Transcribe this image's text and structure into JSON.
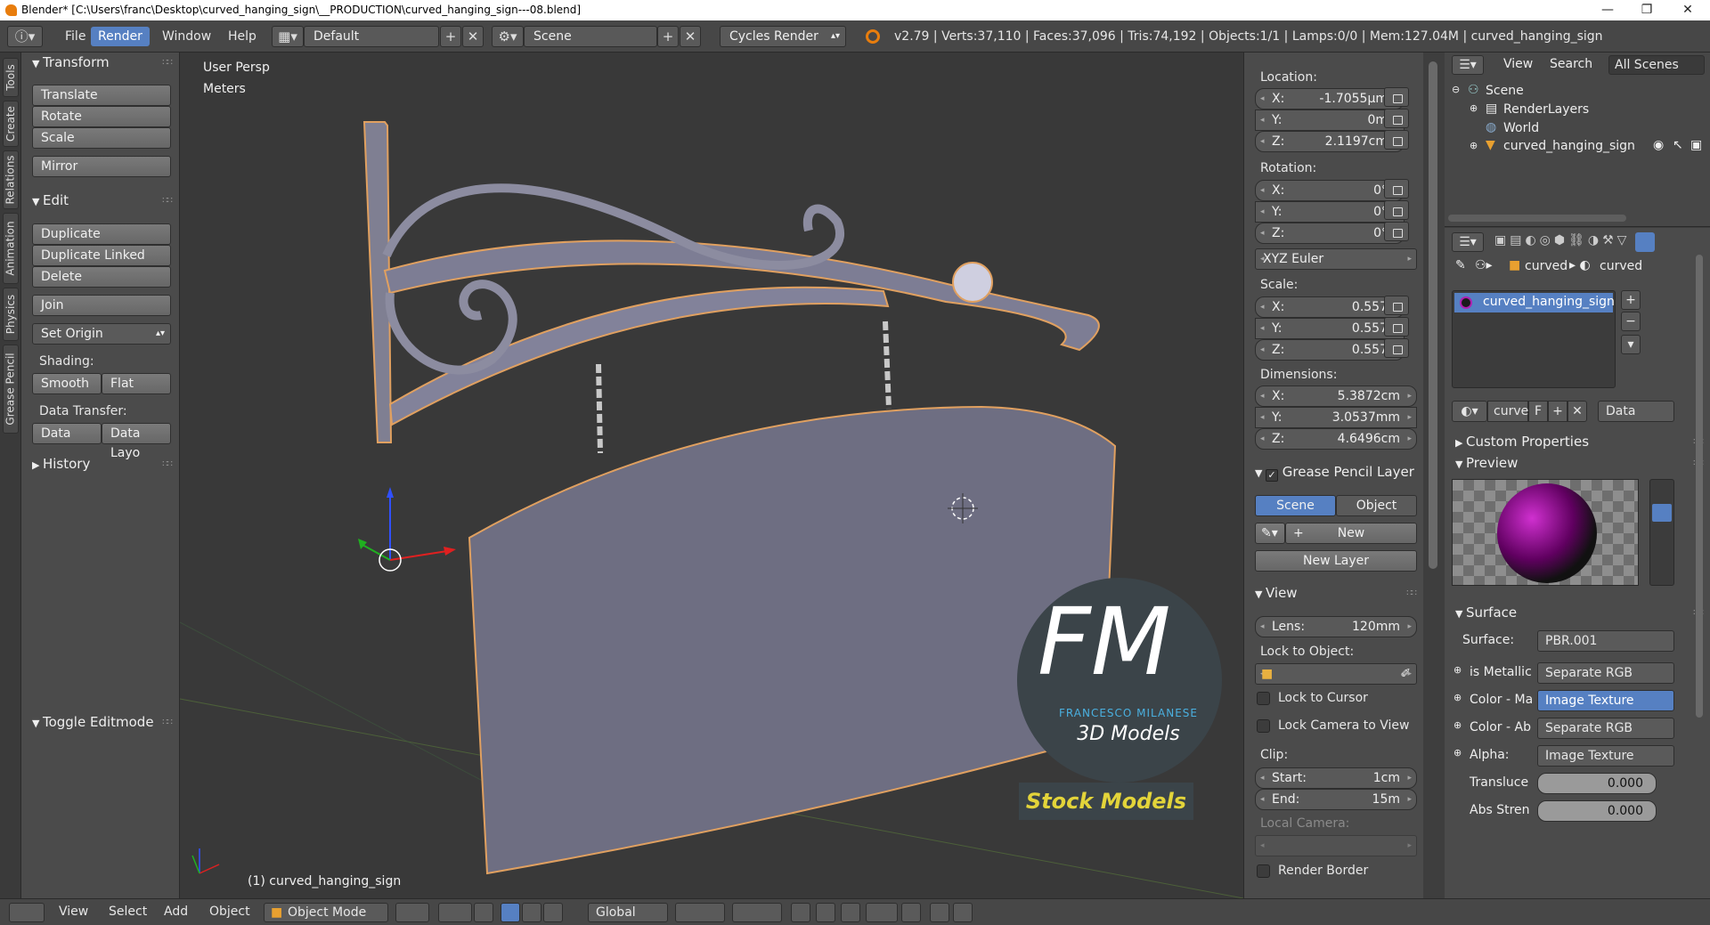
{
  "window": {
    "title": "Blender* [C:\\Users\\franc\\Desktop\\curved_hanging_sign\\__PRODUCTION\\curved_hanging_sign---08.blend]"
  },
  "topbar": {
    "menus": [
      "File",
      "Render",
      "Window",
      "Help"
    ],
    "layout": "Default",
    "scene": "Scene",
    "engine": "Cycles Render",
    "stats": "v2.79 | Verts:37,110 | Faces:37,096 | Tris:74,192 | Objects:1/1 | Lamps:0/0 | Mem:127.04M | curved_hanging_sign"
  },
  "lefttabs": [
    "Tools",
    "Create",
    "Relations",
    "Animation",
    "Physics",
    "Grease Pencil"
  ],
  "toolshelf": {
    "transform_title": "Transform",
    "translate": "Translate",
    "rotate": "Rotate",
    "scale": "Scale",
    "mirror": "Mirror",
    "edit_title": "Edit",
    "duplicate": "Duplicate",
    "duplicate_linked": "Duplicate Linked",
    "delete": "Delete",
    "join": "Join",
    "set_origin": "Set Origin",
    "shading_label": "Shading:",
    "smooth": "Smooth",
    "flat": "Flat",
    "data_transfer_label": "Data Transfer:",
    "data": "Data",
    "data_layo": "Data Layo",
    "history_title": "History",
    "toggle_editmode": "Toggle Editmode"
  },
  "viewport": {
    "view_name": "User Persp",
    "units": "Meters",
    "object_label": "(1) curved_hanging_sign",
    "watermark": {
      "big": "FM",
      "name": "FRANCESCO MILANESE",
      "sub": "3D Models",
      "stock": "Stock Models"
    }
  },
  "npanel": {
    "location_label": "Location:",
    "loc": [
      {
        "k": "X:",
        "v": "-1.7055µm"
      },
      {
        "k": "Y:",
        "v": "0m"
      },
      {
        "k": "Z:",
        "v": "2.1197cm"
      }
    ],
    "rotation_label": "Rotation:",
    "rot": [
      {
        "k": "X:",
        "v": "0°"
      },
      {
        "k": "Y:",
        "v": "0°"
      },
      {
        "k": "Z:",
        "v": "0°"
      }
    ],
    "rotation_mode": "XYZ Euler",
    "scale_label": "Scale:",
    "scl": [
      {
        "k": "X:",
        "v": "0.557"
      },
      {
        "k": "Y:",
        "v": "0.557"
      },
      {
        "k": "Z:",
        "v": "0.557"
      }
    ],
    "dimensions_label": "Dimensions:",
    "dim": [
      {
        "k": "X:",
        "v": "5.3872cm"
      },
      {
        "k": "Y:",
        "v": "3.0537mm"
      },
      {
        "k": "Z:",
        "v": "4.6496cm"
      }
    ],
    "gp_title": "Grease Pencil Layer",
    "gp_scene": "Scene",
    "gp_object": "Object",
    "gp_new": "New",
    "gp_new_layer": "New Layer",
    "view_title": "View",
    "lens_label": "Lens:",
    "lens_value": "120mm",
    "lock_to_object": "Lock to Object:",
    "lock_cursor": "Lock to Cursor",
    "lock_camera": "Lock Camera to View",
    "clip_label": "Clip:",
    "clip_start_label": "Start:",
    "clip_start": "1cm",
    "clip_end_label": "End:",
    "clip_end": "15m",
    "local_camera": "Local Camera:",
    "render_border": "Render Border"
  },
  "outliner": {
    "view": "View",
    "search": "Search",
    "filter": "All Scenes",
    "items": [
      "Scene",
      "RenderLayers",
      "World",
      "curved_hanging_sign"
    ]
  },
  "props": {
    "crumb1": "curved",
    "crumb2": "curved",
    "material_slot": "curved_hanging_sign",
    "mat_name": "curve",
    "mat_f": "F",
    "mat_link": "Data",
    "custom_properties": "Custom Properties",
    "preview": "Preview",
    "surface_title": "Surface",
    "surface_label": "Surface:",
    "surface_value": "PBR.001",
    "rows": [
      {
        "k": "is Metallic",
        "v": "Separate RGB"
      },
      {
        "k": "Color - Ma",
        "v": "Image Texture"
      },
      {
        "k": "Color - Ab",
        "v": "Separate RGB"
      },
      {
        "k": "Alpha:",
        "v": "Image Texture"
      }
    ],
    "transluce_label": "Transluce",
    "transluce_value": "0.000",
    "absstren_label": "Abs Stren",
    "absstren_value": "0.000"
  },
  "bottombar": {
    "view": "View",
    "select": "Select",
    "add": "Add",
    "object": "Object",
    "mode": "Object Mode",
    "orientation": "Global"
  }
}
